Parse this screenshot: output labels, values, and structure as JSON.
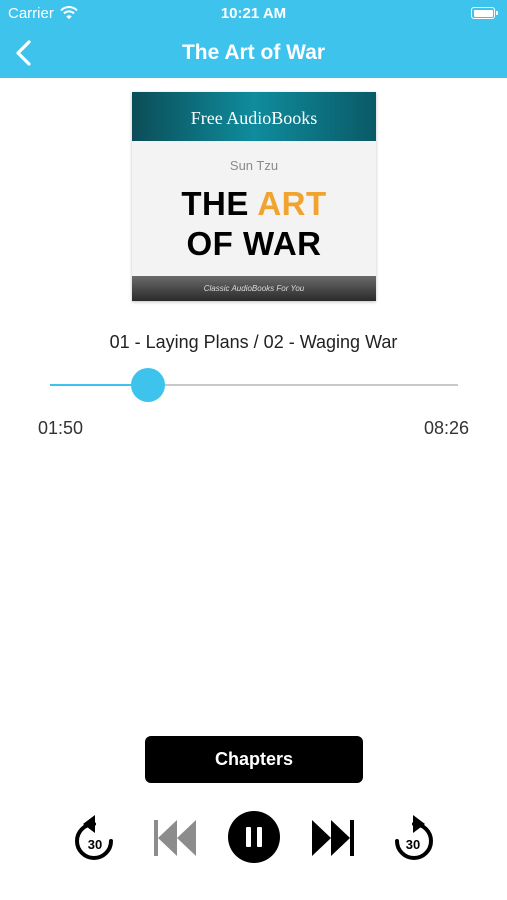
{
  "status_bar": {
    "carrier": "Carrier",
    "time": "10:21 AM"
  },
  "nav": {
    "title": "The Art of War",
    "back_icon": "chevron-left-icon"
  },
  "cover": {
    "publisher": "Free AudioBooks",
    "author": "Sun Tzu",
    "title_line1_plain": "THE ",
    "title_line1_accent": "ART",
    "title_line2": "OF WAR",
    "tagline": "Classic AudioBooks For You",
    "accent_color": "#f0a32e"
  },
  "player": {
    "track_title": "01 - Laying Plans / 02 - Waging War",
    "elapsed": "01:50",
    "total": "08:26",
    "progress_fraction": 0.24
  },
  "controls": {
    "chapters_label": "Chapters",
    "skip_back_seconds": "30",
    "skip_forward_seconds": "30"
  },
  "colors": {
    "accent": "#3ec3ec",
    "track": "#c8c8c8"
  }
}
